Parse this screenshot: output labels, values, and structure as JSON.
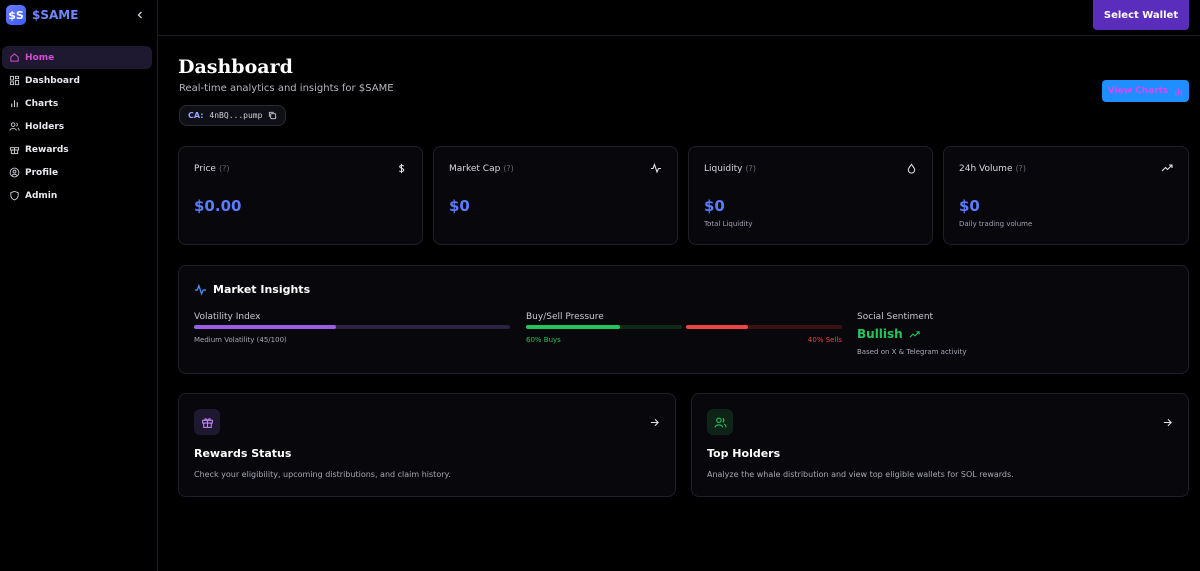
{
  "brand": {
    "logo_text": "$S",
    "name": "$SAME"
  },
  "sidebar": {
    "items": [
      {
        "label": "Home",
        "icon": "home-icon",
        "active": true
      },
      {
        "label": "Dashboard",
        "icon": "dashboard-icon"
      },
      {
        "label": "Charts",
        "icon": "chart-icon"
      },
      {
        "label": "Holders",
        "icon": "users-icon"
      },
      {
        "label": "Rewards",
        "icon": "gift-icon"
      },
      {
        "label": "Profile",
        "icon": "user-circle-icon"
      },
      {
        "label": "Admin",
        "icon": "shield-icon"
      }
    ]
  },
  "topbar": {
    "wallet_label": "Select Wallet"
  },
  "header": {
    "title": "Dashboard",
    "subtitle": "Real-time analytics and insights for $SAME",
    "ca_label": "CA:",
    "ca_address": "4nBQ...pump",
    "view_charts_label": "View Charts"
  },
  "stats": [
    {
      "label": "Price",
      "hint": "(?)",
      "value": "$0.00",
      "sub": "",
      "icon": "dollar-icon"
    },
    {
      "label": "Market Cap",
      "hint": "(?)",
      "value": "$0",
      "sub": "",
      "icon": "activity-icon"
    },
    {
      "label": "Liquidity",
      "hint": "(?)",
      "value": "$0",
      "sub": "Total Liquidity",
      "icon": "droplet-icon"
    },
    {
      "label": "24h Volume",
      "hint": "(?)",
      "value": "$0",
      "sub": "Daily trading volume",
      "icon": "trending-up-icon"
    }
  ],
  "insights": {
    "title": "Market Insights",
    "volatility": {
      "label": "Volatility Index",
      "caption": "Medium Volatility (45/100)",
      "level": 0.45
    },
    "pressure": {
      "label": "Buy/Sell Pressure",
      "buys_label": "60% Buys",
      "sells_label": "40% Sells",
      "buys": 0.6,
      "sells": 0.4
    },
    "sentiment": {
      "label": "Social Sentiment",
      "value": "Bullish",
      "caption": "Based on X & Telegram activity"
    }
  },
  "cards": [
    {
      "title": "Rewards Status",
      "desc": "Check your eligibility, upcoming distributions, and claim history.",
      "icon": "gift-icon"
    },
    {
      "title": "Top Holders",
      "desc": "Analyze the whale distribution and view top eligible wallets for SOL rewards.",
      "icon": "users-icon"
    }
  ],
  "colors": {
    "accent": "#5b7cff",
    "active_nav": "#d44bd6",
    "wallet": "#5b2dbd",
    "buy": "#22c55e",
    "sell": "#ef4444",
    "volatility": "#9b5de5"
  }
}
